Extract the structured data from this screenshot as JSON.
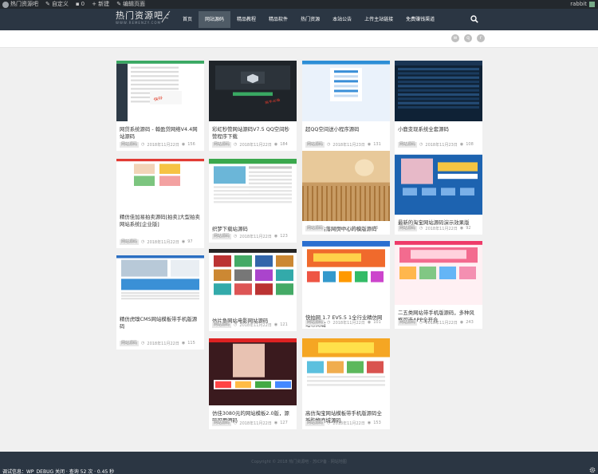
{
  "adminbar": {
    "items": [
      "热门资源吧",
      "自定义",
      "0",
      "+ 新建",
      "编辑页面"
    ],
    "user": "rabbit"
  },
  "header": {
    "logo_text": "热门资源吧",
    "logo_sub": "WWW.REMENZY.COM",
    "nav": [
      "首页",
      "网站源码",
      "精品教程",
      "精品软件",
      "热门资源",
      "本站公告",
      "上传主站链接",
      "免费赚钱渠道"
    ],
    "active_nav": 1
  },
  "social": [
    "weibo-icon",
    "qq-icon",
    "rss-icon"
  ],
  "cards": [
    {
      "title": "网贷系统源码 - 翰盈贷网络V4.4网站源码",
      "date": "2018年11月22日",
      "badge": "网站源码",
      "views": "156",
      "thumb": "admin-green"
    },
    {
      "title": "彩虹秒赞网站源码V7.5 QQ空间秒赞程序下载",
      "date": "2018年11月22日",
      "badge": "网站源码",
      "views": "184",
      "thumb": "dark-panel"
    },
    {
      "title": "超QQ空间送小程序源码",
      "date": "2018年11月23日",
      "badge": "网站源码",
      "views": "131",
      "thumb": "blue-app"
    },
    {
      "title": "小鹿变现系统全套源码",
      "date": "2018年11月23日",
      "badge": "网站源码",
      "views": "108",
      "thumb": "dark-table"
    },
    {
      "title": "精仿佳加易拍卖源码[拍卖]大型拍卖网站系统[企业版]",
      "date": "2018年11月22日",
      "badge": "网站源码",
      "views": "97",
      "thumb": "ecom-red"
    },
    {
      "title": "织梦下载站源码",
      "date": "2018年11月22日",
      "badge": "网站源码",
      "views": "123",
      "thumb": "green-portal"
    },
    {
      "title": "一款网站落网页中心的模版源码",
      "date": "2018年11月22日",
      "badge": "网站源码",
      "views": "65",
      "thumb": "wheat-photo"
    },
    {
      "title": "最新的淘宝网站源码演示效果版",
      "date": "2018年11月22日",
      "badge": "网站源码",
      "views": "92",
      "thumb": "blue-shop"
    },
    {
      "title": "精仿虎嗅CMS网站模板带手机版源码",
      "date": "2018年11月22日",
      "badge": "网站源码",
      "views": "115",
      "thumb": "blue-news"
    },
    {
      "title": "仿片鱼网站电影网站源码",
      "date": "2018年11月22日",
      "badge": "网站源码",
      "views": "121",
      "thumb": "movie-grid"
    },
    {
      "title": "快拍网 1.7 EV5.5 1全行业精仿网站带商城",
      "date": "2018年11月22日",
      "badge": "网站源码",
      "views": "101",
      "thumb": "ecom-blue"
    },
    {
      "title": "二五类网站带手机版源码，多种风格可选APP全开合",
      "date": "2018年11月22日",
      "badge": "网站源码",
      "views": "243",
      "thumb": "pink-mall"
    },
    {
      "title": "仿佳3080元的网站模板2.0版，源码可用源码",
      "date": "2018年11月22日",
      "badge": "网站源码",
      "views": "127",
      "thumb": "dark-shop"
    },
    {
      "title": "高仿淘宝网站模板带手机版源码全新购物商城源码",
      "date": "2018年11月22日",
      "badge": "网站源码",
      "views": "153",
      "thumb": "orange-school"
    }
  ],
  "footer": {
    "copyright": "Copyright © 2018 热门资源吧 · 苏ICP备 · 网站地图",
    "debug": "调试信息：WP_DEBUG 关闭 · 查询 52 次 · 0.45 秒"
  }
}
